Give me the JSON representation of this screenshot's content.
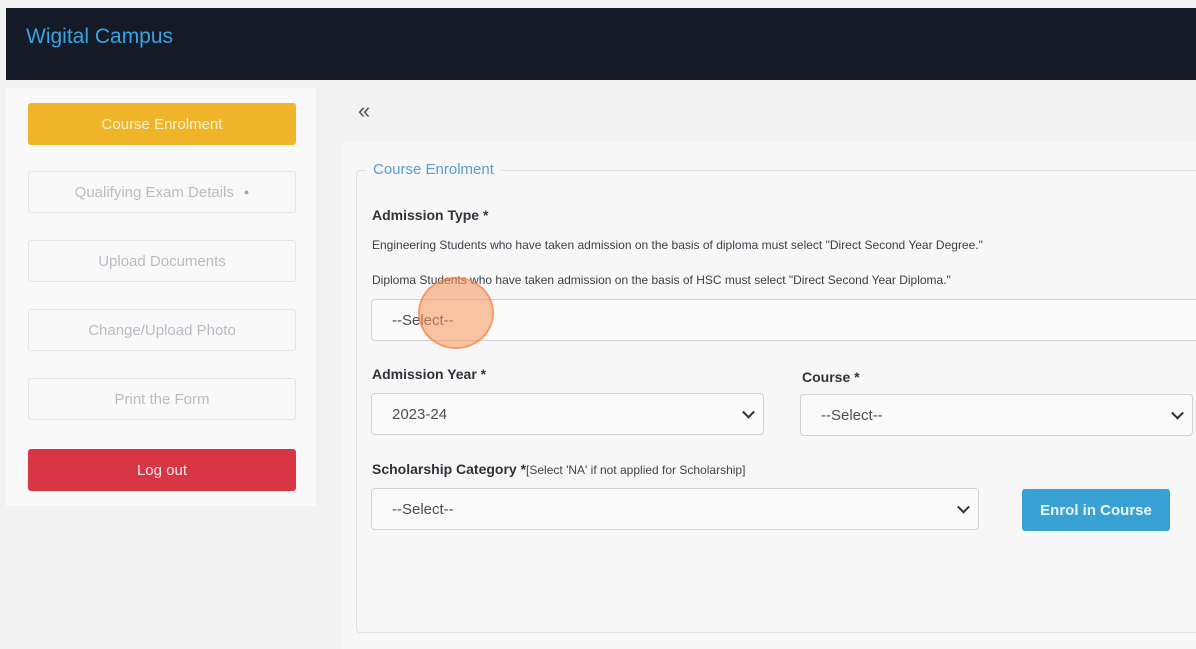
{
  "app": {
    "title": "Wigital Campus"
  },
  "sidebar": {
    "items": [
      {
        "label": "Course Enrolment"
      },
      {
        "label": "Qualifying Exam Details",
        "badge": "●"
      },
      {
        "label": "Upload Documents"
      },
      {
        "label": "Change/Upload Photo"
      },
      {
        "label": "Print the Form"
      }
    ],
    "logout_label": "Log out"
  },
  "main": {
    "collapse_icon": "«",
    "section_title": "Course Enrolment",
    "admission_type": {
      "label": "Admission Type *",
      "help1": "Engineering Students who have taken admission on the basis of diploma must select \"Direct Second Year Degree.\"",
      "help2": "Diploma Students who have taken admission on the basis of HSC must select \"Direct Second Year Diploma.\"",
      "value": "--Select--"
    },
    "admission_year": {
      "label": "Admission Year *",
      "value": "2023-24"
    },
    "course": {
      "label": "Course *",
      "value": "--Select--"
    },
    "scholarship": {
      "label": "Scholarship Category *",
      "note": "[Select 'NA' if not applied for Scholarship]",
      "value": "--Select--"
    },
    "enrol_button": "Enrol in Course"
  },
  "colors": {
    "active": "#f0b429",
    "logout": "#d93645",
    "primary": "#3aa1d4",
    "brand": "#3aa3e3"
  }
}
